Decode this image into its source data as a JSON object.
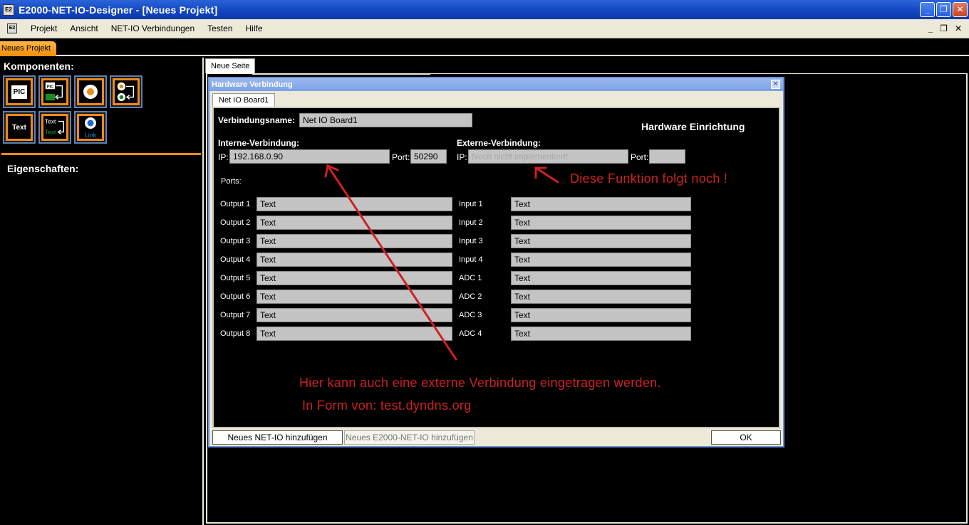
{
  "window": {
    "title": "E2000-NET-IO-Designer - [Neues Projekt]",
    "icon_text": "E2 IO"
  },
  "menu": {
    "items": [
      "Projekt",
      "Ansicht",
      "NET-IO Verbindungen",
      "Testen",
      "Hilfe"
    ]
  },
  "project_tab": "Neues Projekt",
  "left_panel": {
    "components_title": "Komponenten:",
    "properties_title": "Eigenschaften:",
    "components": [
      {
        "name": "pic",
        "text": "PIC"
      },
      {
        "name": "pic-link",
        "text": "PIC"
      },
      {
        "name": "orange-dot",
        "text": ""
      },
      {
        "name": "dot-link",
        "text": ""
      },
      {
        "name": "text",
        "text": "Text"
      },
      {
        "name": "text-link",
        "text": "Text"
      },
      {
        "name": "link",
        "text": "Link"
      }
    ]
  },
  "page_tab": "Neue Seite",
  "dialog": {
    "title": "Hardware Verbindung",
    "tab": "Net IO Board1",
    "connection_name_label": "Verbindungsname:",
    "connection_name_value": "Net IO Board1",
    "heading": "Hardware Einrichtung",
    "internal_label": "Interne-Verbindung:",
    "external_label": "Externe-Verbindung:",
    "ip_label": "IP:",
    "port_label": "Port:",
    "internal_ip": "192.168.0.90",
    "internal_port": "50290",
    "external_ip_placeholder": "Noch nicht implementiert!",
    "external_port": "",
    "ports_label": "Ports:",
    "outputs": [
      {
        "label": "Output 1",
        "value": "Text"
      },
      {
        "label": "Output 2",
        "value": "Text"
      },
      {
        "label": "Output 3",
        "value": "Text"
      },
      {
        "label": "Output 4",
        "value": "Text"
      },
      {
        "label": "Output 5",
        "value": "Text"
      },
      {
        "label": "Output 6",
        "value": "Text"
      },
      {
        "label": "Output 7",
        "value": "Text"
      },
      {
        "label": "Output 8",
        "value": "Text"
      }
    ],
    "inputs": [
      {
        "label": "Input 1",
        "value": "Text"
      },
      {
        "label": "Input 2",
        "value": "Text"
      },
      {
        "label": "Input 3",
        "value": "Text"
      },
      {
        "label": "Input 4",
        "value": "Text"
      },
      {
        "label": "ADC 1",
        "value": "Text"
      },
      {
        "label": "ADC 2",
        "value": "Text"
      },
      {
        "label": "ADC 3",
        "value": "Text"
      },
      {
        "label": "ADC 4",
        "value": "Text"
      }
    ],
    "buttons": {
      "add_netio": "Neues NET-IO hinzufügen",
      "add_e2000": "Neues E2000-NET-IO hinzufügen",
      "ok": "OK"
    }
  },
  "annotations": {
    "note_function": "Diese Funktion folgt noch !",
    "note_external_1": "Hier kann auch eine externe Verbindung eingetragen werden.",
    "note_external_2": "In Form von: test.dyndns.org",
    "color": "#cc2222"
  },
  "colors": {
    "accent_orange": "#f08a18",
    "titlebar_blue": "#1244c0",
    "panel_bg": "#000000"
  }
}
